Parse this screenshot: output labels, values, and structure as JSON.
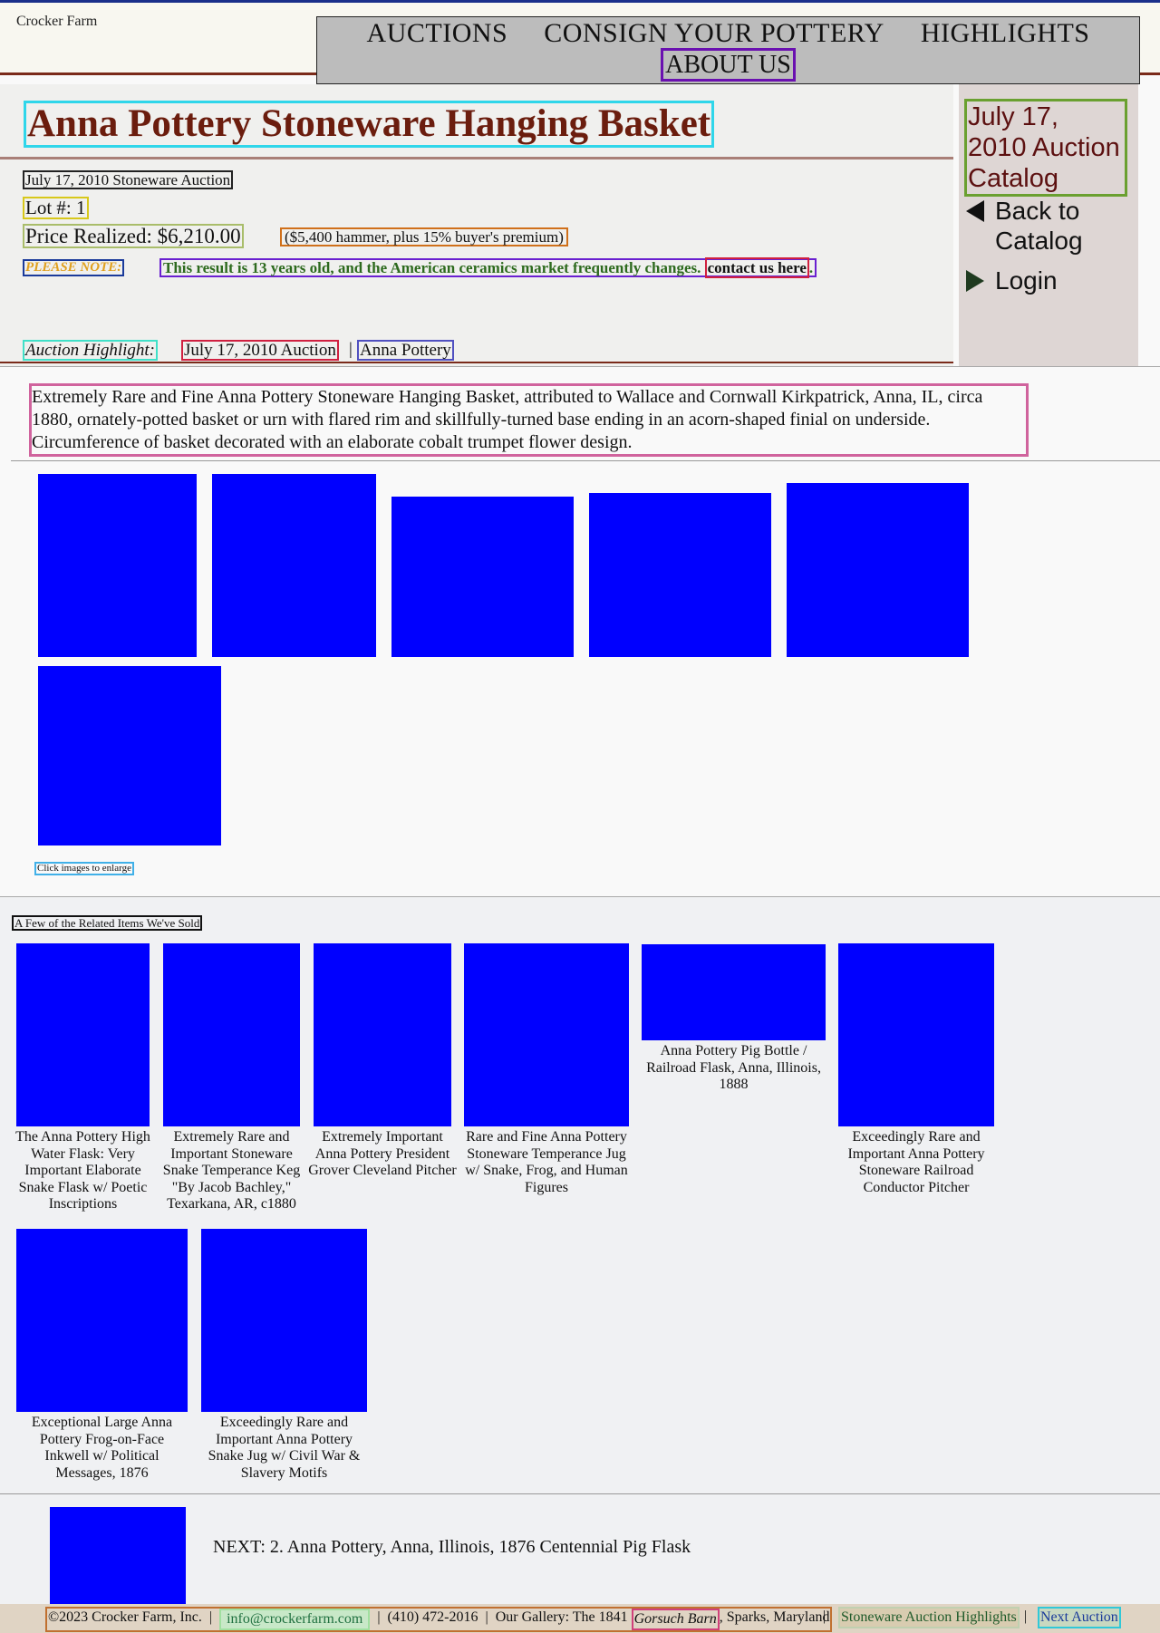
{
  "header": {
    "logo_alt": "Crocker Farm",
    "nav": [
      "AUCTIONS",
      "CONSIGN YOUR POTTERY",
      "HIGHLIGHTS"
    ],
    "nav_about": "ABOUT US"
  },
  "lot": {
    "title": "Anna Pottery Stoneware Hanging Basket",
    "auction": "July 17, 2010 Stoneware Auction",
    "lot_number": "Lot #: 1",
    "price": "Price Realized: $6,210.00",
    "premium_note": "($5,400 hammer, plus 15% buyer's premium)",
    "please_note": "PLEASE NOTE:",
    "note_text": "This result is 13 years old, and the American ceramics market frequently changes.",
    "contact_link": "contact us here",
    "note_end": ".",
    "highlight_label": "Auction Highlight:",
    "highlight_auction": "July 17, 2010 Auction",
    "highlight_sep": "|",
    "highlight_category": "Anna Pottery",
    "description": "Extremely Rare and Fine Anna Pottery Stoneware Hanging Basket, attributed to Wallace and Cornwall Kirkpatrick, Anna, IL, circa 1880, ornately-potted basket or urn with flared rim and skillfully-turned base ending in an acorn-shaped finial on underside. Circumference of basket decorated with an elaborate cobalt trumpet flower design.",
    "enlarge_hint": "Click images to enlarge"
  },
  "sidebar": {
    "catalog_title": "July 17, 2010 Auction Catalog",
    "back": "Back to Catalog",
    "login": "Login"
  },
  "related": {
    "heading": "A Few of the Related Items We've Sold",
    "items": [
      "The Anna Pottery High Water Flask: Very Important Elaborate Snake Flask w/ Poetic Inscriptions",
      "Extremely Rare and Important Stoneware Snake Temperance Keg \"By Jacob Bachley,\" Texarkana, AR, c1880",
      "Extremely Important Anna Pottery President Grover Cleveland Pitcher",
      "Rare and Fine Anna Pottery Stoneware Temperance Jug w/ Snake, Frog, and Human Figures",
      "Anna Pottery Pig Bottle / Railroad Flask, Anna, Illinois, 1888",
      "Exceedingly Rare and Important Anna Pottery Stoneware Railroad Conductor Pitcher",
      "Exceptional Large Anna Pottery Frog-on-Face Inkwell w/ Political Messages, 1876",
      "Exceedingly Rare and Important Anna Pottery Snake Jug w/ Civil War & Slavery Motifs"
    ]
  },
  "next": {
    "label": "NEXT: 2. Anna Pottery, Anna, Illinois, 1876 Centennial Pig Flask"
  },
  "footer": {
    "copyright": "©2023 Crocker Farm, Inc.",
    "sep": "|",
    "email": "info@crockerfarm.com",
    "phone": "(410) 472-2016",
    "gallery": "Our Gallery: The 1841",
    "barn": "Gorsuch Barn",
    "location": ", Sparks, Maryland",
    "highlights": "Stoneware Auction Highlights",
    "next_auction": "Next Auction"
  },
  "colors": {
    "title": "#6b1d0e",
    "image_placeholder": "#0000ff",
    "please_note": "#e0a020",
    "note_text": "#2d6a1e"
  }
}
